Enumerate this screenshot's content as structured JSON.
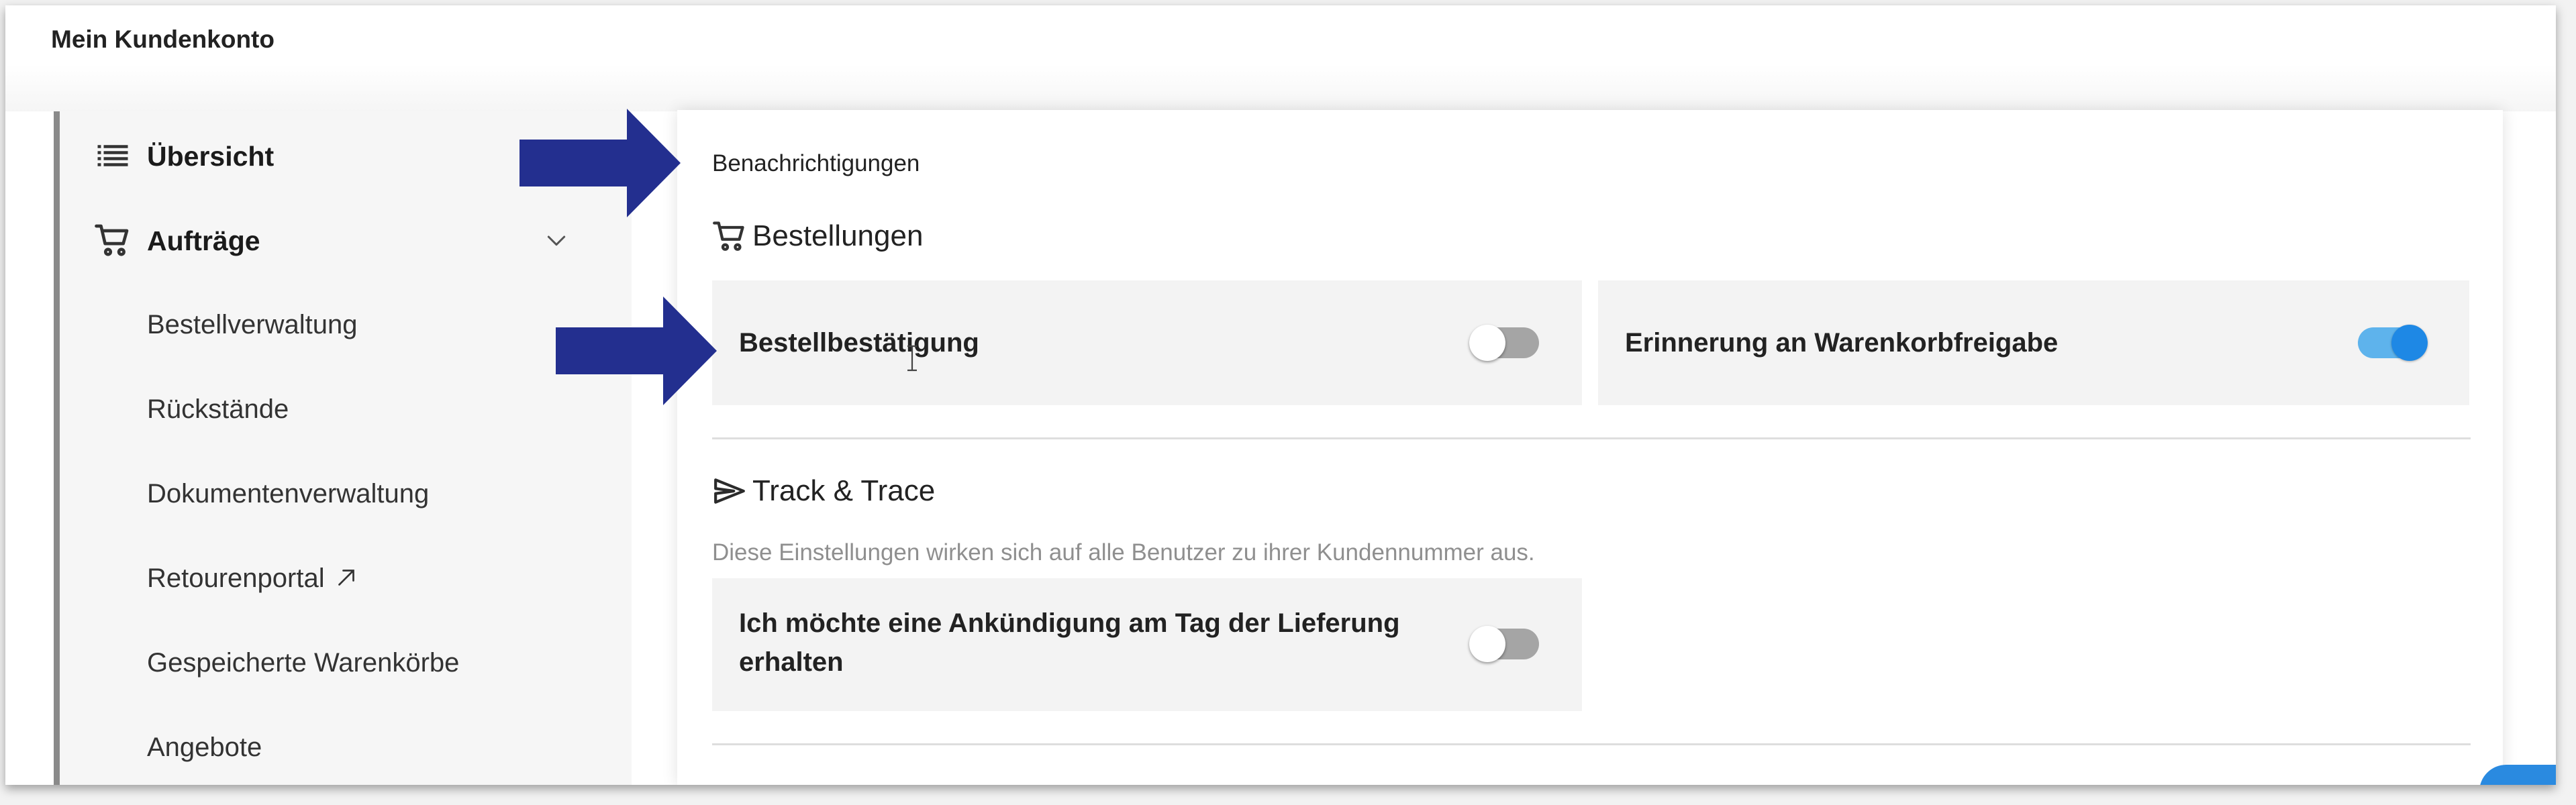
{
  "page_title": "Mein Kundenkonto",
  "sidebar": {
    "items": [
      {
        "label": "Übersicht",
        "icon": "list-icon",
        "level": "main"
      },
      {
        "label": "Aufträge",
        "icon": "cart-icon",
        "level": "main",
        "expanded": true
      },
      {
        "label": "Bestellverwaltung",
        "level": "sub"
      },
      {
        "label": "Rückstände",
        "level": "sub"
      },
      {
        "label": "Dokumentenverwaltung",
        "level": "sub"
      },
      {
        "label": "Retourenportal",
        "level": "sub",
        "icon": "external-link-icon"
      },
      {
        "label": "Gespeicherte Warenkörbe",
        "level": "sub"
      },
      {
        "label": "Angebote",
        "level": "sub"
      }
    ]
  },
  "main": {
    "heading": "Benachrichtigungen",
    "sections": [
      {
        "title": "Bestellungen",
        "icon": "cart-icon",
        "settings": [
          {
            "label": "Bestellbestätigung",
            "enabled": false
          },
          {
            "label": "Erinnerung an Warenkorbfreigabe",
            "enabled": true
          }
        ]
      },
      {
        "title": "Track & Trace",
        "icon": "send-icon",
        "note": "Diese Einstellungen wirken sich auf alle Benutzer zu ihrer Kundennummer aus.",
        "settings": [
          {
            "label_line1": "Ich möchte eine Ankündigung am Tag der Lieferung",
            "label_line2": "erhalten",
            "enabled": false
          }
        ]
      }
    ]
  },
  "annotations": {
    "arrow_color": "#232f8f"
  },
  "colors": {
    "toggle_on": "#1e88e5",
    "toggle_on_track": "#5eb3ec",
    "toggle_off_track": "#a5a5a5",
    "card_bg": "#f3f3f3"
  }
}
